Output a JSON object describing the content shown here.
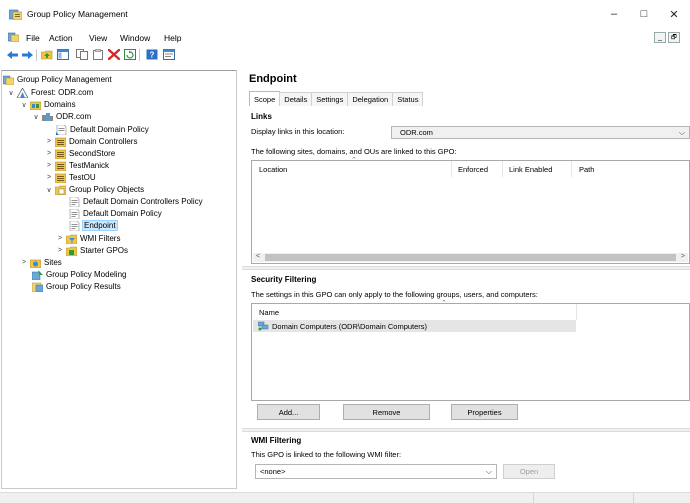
{
  "window": {
    "title": "Group Policy Management",
    "minimize_glyph": "–",
    "maximize_glyph": "□",
    "close_glyph": "✕"
  },
  "menu": {
    "items": [
      "File",
      "Action",
      "View",
      "Window",
      "Help"
    ],
    "mdi_min": "_",
    "mdi_restore": "🗗"
  },
  "toolbar": {
    "icons": [
      "back-arrow-icon",
      "forward-arrow-icon",
      "up-folder-icon",
      "show-tree-icon",
      "copy-icon",
      "paste-icon",
      "delete-icon",
      "refresh-icon",
      "help-icon",
      "console-icon"
    ]
  },
  "tree": {
    "nodes": [
      {
        "label": "Group Policy Management",
        "icon": "gpm-icon",
        "chevron": ""
      },
      {
        "label": "Forest: ODR.com",
        "icon": "forest-icon",
        "chevron": "∨"
      },
      {
        "label": "Domains",
        "icon": "domains-icon",
        "chevron": "∨"
      },
      {
        "label": "ODR.com",
        "icon": "domain-icon",
        "chevron": "∨"
      },
      {
        "label": "Default Domain Policy",
        "icon": "gpo-link-icon",
        "chevron": ""
      },
      {
        "label": "Domain Controllers",
        "icon": "ou-icon",
        "chevron": ">"
      },
      {
        "label": "SecondStore",
        "icon": "ou-icon",
        "chevron": ">"
      },
      {
        "label": "TestManick",
        "icon": "ou-icon",
        "chevron": ">"
      },
      {
        "label": "TestOU",
        "icon": "ou-icon",
        "chevron": ">"
      },
      {
        "label": "Group Policy Objects",
        "icon": "gpo-folder-icon",
        "chevron": "∨"
      },
      {
        "label": "Default Domain Controllers Policy",
        "icon": "gpo-icon",
        "chevron": ""
      },
      {
        "label": "Default Domain Policy",
        "icon": "gpo-icon",
        "chevron": ""
      },
      {
        "label": "Endpoint",
        "icon": "gpo-icon",
        "chevron": "",
        "selected": true
      },
      {
        "label": "WMI Filters",
        "icon": "wmi-folder-icon",
        "chevron": ">"
      },
      {
        "label": "Starter GPOs",
        "icon": "starter-folder-icon",
        "chevron": ">"
      },
      {
        "label": "Sites",
        "icon": "sites-icon",
        "chevron": ">"
      },
      {
        "label": "Group Policy Modeling",
        "icon": "modeling-icon",
        "chevron": ""
      },
      {
        "label": "Group Policy Results",
        "icon": "results-icon",
        "chevron": ""
      }
    ]
  },
  "right": {
    "title": "Endpoint",
    "tabs": [
      "Scope",
      "Details",
      "Settings",
      "Delegation",
      "Status"
    ],
    "links": {
      "heading": "Links",
      "display_label": "Display links in this location:",
      "location_value": "ODR.com",
      "linked_text": "The following sites, domains, and OUs are linked to this GPO:",
      "columns": [
        "Location",
        "Enforced",
        "Link Enabled",
        "Path"
      ]
    },
    "security": {
      "heading": "Security Filtering",
      "description": "The settings in this GPO can only apply to the following groups, users, and computers:",
      "column": "Name",
      "entries": [
        "Domain Computers (ODR\\Domain Computers)"
      ],
      "buttons": {
        "add": "Add...",
        "remove": "Remove",
        "properties": "Properties"
      }
    },
    "wmi": {
      "heading": "WMI Filtering",
      "description": "This GPO is linked to the following WMI filter:",
      "filter_value": "<none>",
      "open_button": "Open"
    }
  },
  "colors": {
    "selection": "#cce8ff",
    "accent": "#0078d7"
  }
}
